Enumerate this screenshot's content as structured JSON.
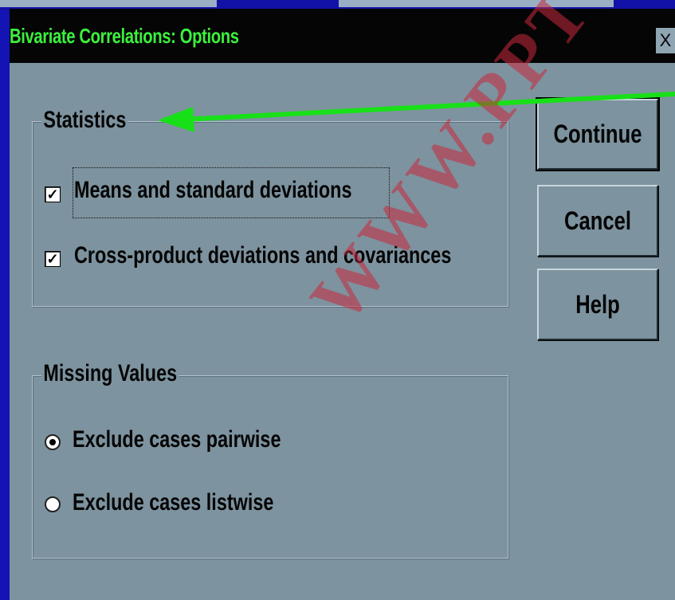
{
  "window": {
    "title": "Bivariate Correlations: Options",
    "close_label": "X"
  },
  "statistics": {
    "legend": "Statistics",
    "options": [
      {
        "label": "Means and standard deviations",
        "checked": true
      },
      {
        "label": "Cross-product deviations and covariances",
        "checked": true
      }
    ]
  },
  "missing_values": {
    "legend": "Missing Values",
    "options": [
      {
        "label": "Exclude cases pairwise",
        "selected": true
      },
      {
        "label": "Exclude cases listwise",
        "selected": false
      }
    ]
  },
  "buttons": {
    "continue": "Continue",
    "cancel": "Cancel",
    "help": "Help"
  },
  "annotation": {
    "arrow_color": "#18e018"
  },
  "watermark": {
    "text": "WWW.PPT"
  },
  "colors": {
    "dialog_bg": "#7d939f",
    "title_text": "#3cf03c",
    "desktop_bg": "#1414b4"
  }
}
